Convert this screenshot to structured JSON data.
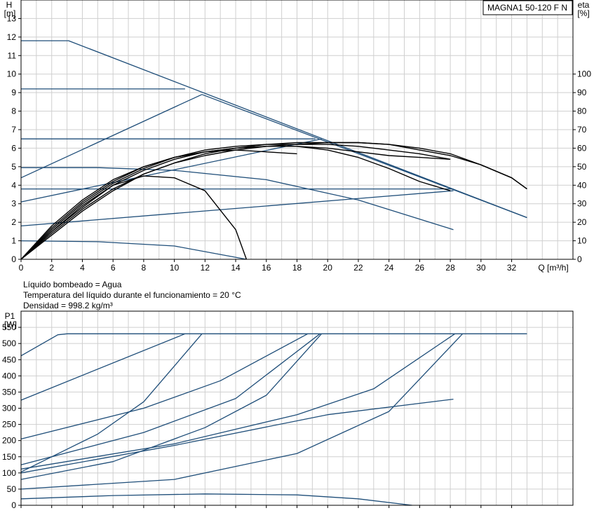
{
  "chart_data": [
    {
      "type": "line",
      "model_label": "MAGNA1 50-120 F N",
      "xlabel": "Q [m³/h]",
      "ylabel_left": [
        "H",
        "[m]"
      ],
      "ylabel_right": [
        "eta",
        "[%]"
      ],
      "xlim": [
        0,
        36
      ],
      "ylim": [
        0,
        14
      ],
      "xticks": [
        0,
        2,
        4,
        6,
        8,
        10,
        12,
        14,
        16,
        18,
        20,
        22,
        24,
        26,
        28,
        30,
        32
      ],
      "yticks": [
        0,
        1,
        2,
        3,
        4,
        5,
        6,
        7,
        8,
        9,
        10,
        11,
        12,
        13
      ],
      "y2lim": [
        0,
        140
      ],
      "y2ticks": [
        0,
        10,
        20,
        30,
        40,
        50,
        60,
        70,
        80,
        90,
        100
      ],
      "grid": true,
      "series": [
        {
          "role": "head",
          "color": "#1f4e79",
          "points": [
            [
              0,
              11.8
            ],
            [
              3.1,
              11.8
            ],
            [
              33,
              2.25
            ]
          ]
        },
        {
          "role": "head",
          "color": "#1f4e79",
          "points": [
            [
              0,
              9.2
            ],
            [
              10.7,
              9.2
            ]
          ]
        },
        {
          "role": "head",
          "color": "#1f4e79",
          "points": [
            [
              0,
              6.5
            ],
            [
              19.2,
              6.5
            ]
          ]
        },
        {
          "role": "head",
          "color": "#1f4e79",
          "points": [
            [
              0,
              4.95
            ],
            [
              5,
              4.95
            ],
            [
              10,
              4.8
            ],
            [
              16,
              4.3
            ],
            [
              22,
              3.2
            ],
            [
              28.2,
              1.6
            ]
          ]
        },
        {
          "role": "head",
          "color": "#1f4e79",
          "points": [
            [
              0,
              3.8
            ],
            [
              28.2,
              3.8
            ]
          ]
        },
        {
          "role": "head",
          "color": "#1f4e79",
          "points": [
            [
              0,
              1.0
            ],
            [
              5,
              0.95
            ],
            [
              10,
              0.72
            ],
            [
              14.7,
              0
            ]
          ]
        },
        {
          "role": "limit",
          "color": "#1f4e79",
          "points": [
            [
              0,
              4.4
            ],
            [
              11.8,
              8.9
            ]
          ]
        },
        {
          "role": "limit",
          "color": "#1f4e79",
          "points": [
            [
              0,
              3.1
            ],
            [
              19.6,
              6.5
            ]
          ]
        },
        {
          "role": "limit",
          "color": "#1f4e79",
          "points": [
            [
              0,
              1.8
            ],
            [
              28.2,
              3.7
            ]
          ]
        },
        {
          "role": "limit",
          "color": "#1f4e79",
          "points": [
            [
              11.8,
              8.9
            ],
            [
              33,
              2.25
            ]
          ]
        },
        {
          "role": "efficiency",
          "color": "#000000",
          "points": [
            [
              0,
              0
            ],
            [
              2,
              15
            ],
            [
              4,
              29
            ],
            [
              6,
              40
            ],
            [
              8,
              45
            ],
            [
              10,
              44
            ],
            [
              12,
              37
            ],
            [
              14,
              16
            ],
            [
              14.7,
              0
            ]
          ]
        },
        {
          "role": "efficiency",
          "color": "#000000",
          "points": [
            [
              0,
              0
            ],
            [
              2,
              18
            ],
            [
              4,
              32
            ],
            [
              6,
              43
            ],
            [
              8,
              50
            ],
            [
              10,
              55
            ],
            [
              12,
              58
            ],
            [
              14,
              60
            ],
            [
              16,
              61
            ],
            [
              18,
              61
            ],
            [
              20,
              59
            ],
            [
              22,
              55
            ],
            [
              24,
              49
            ],
            [
              26,
              42
            ],
            [
              28,
              37
            ]
          ]
        },
        {
          "role": "efficiency",
          "color": "#000000",
          "points": [
            [
              0,
              0
            ],
            [
              2,
              17
            ],
            [
              4,
              31
            ],
            [
              6,
              42
            ],
            [
              8,
              50
            ],
            [
              10,
              55
            ],
            [
              12,
              58
            ],
            [
              14,
              59
            ],
            [
              16,
              58
            ],
            [
              18,
              57
            ]
          ]
        },
        {
          "role": "efficiency",
          "color": "#000000",
          "points": [
            [
              0,
              0
            ],
            [
              2,
              14
            ],
            [
              4,
              27
            ],
            [
              6,
              38
            ],
            [
              8,
              46
            ],
            [
              10,
              52
            ],
            [
              12,
              56
            ],
            [
              14,
              59
            ],
            [
              16,
              61
            ],
            [
              18,
              62
            ],
            [
              20,
              62
            ],
            [
              22,
              61
            ],
            [
              24,
              59
            ],
            [
              26,
              57
            ],
            [
              28,
              54
            ]
          ]
        },
        {
          "role": "efficiency",
          "color": "#000000",
          "points": [
            [
              0,
              0
            ],
            [
              2,
              16
            ],
            [
              4,
              30
            ],
            [
              6,
              41
            ],
            [
              8,
              49
            ],
            [
              10,
              55
            ],
            [
              12,
              59
            ],
            [
              14,
              61
            ],
            [
              16,
              62
            ],
            [
              18,
              62
            ],
            [
              20,
              63
            ],
            [
              22,
              63
            ],
            [
              24,
              62
            ],
            [
              26,
              60
            ],
            [
              28,
              57
            ],
            [
              30,
              51
            ],
            [
              32,
              44
            ],
            [
              33,
              38
            ]
          ]
        },
        {
          "role": "efficiency",
          "color": "#000000",
          "points": [
            [
              0,
              0
            ],
            [
              2,
              13
            ],
            [
              4,
              26
            ],
            [
              6,
              37
            ],
            [
              8,
              46
            ],
            [
              10,
              52
            ],
            [
              12,
              57
            ],
            [
              14,
              60
            ],
            [
              16,
              62
            ],
            [
              18,
              63
            ],
            [
              20,
              63
            ],
            [
              22,
              63
            ],
            [
              24,
              62
            ],
            [
              26,
              59
            ],
            [
              28,
              56
            ],
            [
              30,
              51
            ],
            [
              32,
              44
            ],
            [
              33,
              38
            ]
          ]
        },
        {
          "role": "efficiency",
          "color": "#000000",
          "points": [
            [
              0,
              0
            ],
            [
              2,
              15
            ],
            [
              4,
              28
            ],
            [
              6,
              40
            ],
            [
              8,
              48
            ],
            [
              10,
              54
            ],
            [
              12,
              58
            ],
            [
              14,
              60
            ],
            [
              16,
              61
            ],
            [
              18,
              61
            ],
            [
              20,
              60
            ],
            [
              22,
              58
            ],
            [
              24,
              56
            ],
            [
              26,
              55
            ],
            [
              28,
              54
            ]
          ]
        }
      ]
    },
    {
      "type": "line",
      "ylabel": [
        "P1",
        "[W]"
      ],
      "xlim": [
        0,
        36
      ],
      "ylim": [
        0,
        600
      ],
      "xticks": [
        0,
        2,
        4,
        6,
        8,
        10,
        12,
        14,
        16,
        18,
        20,
        22,
        24,
        26,
        28,
        30,
        32
      ],
      "yticks": [
        0,
        50,
        100,
        150,
        200,
        250,
        300,
        350,
        400,
        450,
        500,
        550
      ],
      "grid": true,
      "series": [
        {
          "color": "#1f4e79",
          "points": [
            [
              0,
              462
            ],
            [
              2.4,
              527
            ],
            [
              3,
              530
            ],
            [
              33,
              530
            ]
          ]
        },
        {
          "color": "#1f4e79",
          "points": [
            [
              0,
              325
            ],
            [
              10.7,
              530
            ]
          ]
        },
        {
          "color": "#1f4e79",
          "points": [
            [
              0,
              205
            ],
            [
              8,
              300
            ],
            [
              13,
              385
            ],
            [
              18.7,
              530
            ]
          ]
        },
        {
          "color": "#1f4e79",
          "points": [
            [
              0,
              103
            ],
            [
              5,
              220
            ],
            [
              8,
              320
            ],
            [
              11.8,
              530
            ]
          ]
        },
        {
          "color": "#1f4e79",
          "points": [
            [
              0,
              125
            ],
            [
              8,
              225
            ],
            [
              14,
              330
            ],
            [
              19.5,
              530
            ]
          ]
        },
        {
          "color": "#1f4e79",
          "points": [
            [
              0,
              80
            ],
            [
              6,
              135
            ],
            [
              12,
              240
            ],
            [
              16,
              340
            ],
            [
              19.6,
              530
            ]
          ]
        },
        {
          "color": "#1f4e79",
          "points": [
            [
              0,
              100
            ],
            [
              10,
              185
            ],
            [
              20,
              280
            ],
            [
              28.2,
              328
            ]
          ]
        },
        {
          "color": "#1f4e79",
          "points": [
            [
              0,
              112
            ],
            [
              10,
              190
            ],
            [
              18,
              280
            ],
            [
              23,
              360
            ],
            [
              28.3,
              530
            ]
          ]
        },
        {
          "color": "#1f4e79",
          "points": [
            [
              0,
              50
            ],
            [
              10,
              80
            ],
            [
              18,
              160
            ],
            [
              24,
              290
            ],
            [
              28.8,
              530
            ]
          ]
        },
        {
          "color": "#1f4e79",
          "points": [
            [
              0,
              20
            ],
            [
              6,
              30
            ],
            [
              12,
              35
            ],
            [
              18,
              32
            ],
            [
              22,
              20
            ],
            [
              25.5,
              0
            ]
          ]
        }
      ]
    }
  ],
  "fluid_notes": [
    "Líquido bombeado = Agua",
    "Temperatura del líquido durante el funcionamiento = 20 °C",
    "Densidad = 998.2 kg/m³"
  ]
}
